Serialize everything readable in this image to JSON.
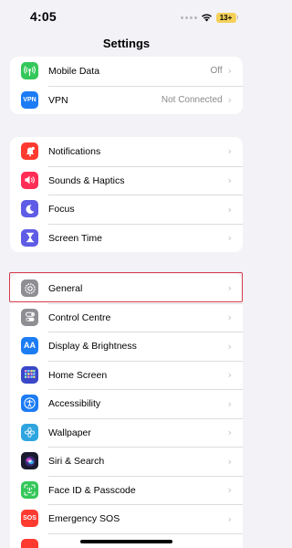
{
  "status_bar": {
    "time": "4:05",
    "battery": "13+"
  },
  "nav": {
    "title": "Settings"
  },
  "groups": {
    "connectivity": [
      {
        "label": "Mobile Data",
        "value": "Off",
        "icon": "antenna-icon",
        "color": "#34c759"
      },
      {
        "label": "VPN",
        "value": "Not Connected",
        "icon": "vpn-icon",
        "icon_text": "VPN",
        "color": "#1c7cf4"
      }
    ],
    "alerts": [
      {
        "label": "Notifications",
        "icon": "bell-icon",
        "color": "#ff3b30"
      },
      {
        "label": "Sounds & Haptics",
        "icon": "speaker-icon",
        "color": "#ff2d55"
      },
      {
        "label": "Focus",
        "icon": "moon-icon",
        "color": "#5e5ce6"
      },
      {
        "label": "Screen Time",
        "icon": "hourglass-icon",
        "color": "#5e5ce6"
      }
    ],
    "system": [
      {
        "label": "General",
        "icon": "gear-icon",
        "color": "#8e8e93"
      },
      {
        "label": "Control Centre",
        "icon": "toggles-icon",
        "color": "#8e8e93"
      },
      {
        "label": "Display & Brightness",
        "icon": "text-size-icon",
        "icon_text": "AA",
        "color": "#1c7cf4"
      },
      {
        "label": "Home Screen",
        "icon": "app-grid-icon",
        "color": "#3a47c9"
      },
      {
        "label": "Accessibility",
        "icon": "accessibility-icon",
        "color": "#1c7cf4"
      },
      {
        "label": "Wallpaper",
        "icon": "flower-icon",
        "color": "#2fa5e0"
      },
      {
        "label": "Siri & Search",
        "icon": "siri-icon",
        "color": "#1a1a2e"
      },
      {
        "label": "Face ID & Passcode",
        "icon": "face-id-icon",
        "color": "#34c759"
      },
      {
        "label": "Emergency SOS",
        "icon": "sos-icon",
        "icon_text": "SOS",
        "color": "#ff3b30"
      }
    ]
  },
  "chevron_glyph": "›"
}
